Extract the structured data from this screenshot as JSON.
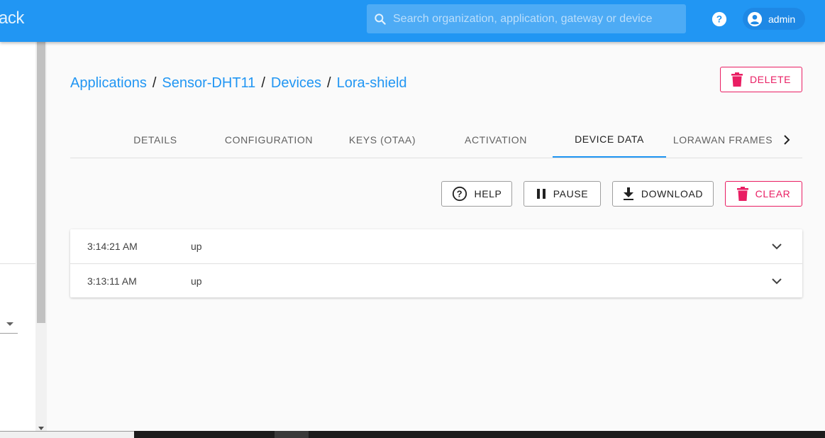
{
  "header": {
    "brand": "ack",
    "search_placeholder": "Search organization, application, gateway or device",
    "user_name": "admin"
  },
  "breadcrumb": {
    "items": [
      "Applications",
      "Sensor-DHT11",
      "Devices",
      "Lora-shield"
    ],
    "separator": "/"
  },
  "actions": {
    "delete_label": "DELETE"
  },
  "tabs": [
    {
      "label": "DETAILS",
      "active": false
    },
    {
      "label": "CONFIGURATION",
      "active": false
    },
    {
      "label": "KEYS (OTAA)",
      "active": false
    },
    {
      "label": "ACTIVATION",
      "active": false
    },
    {
      "label": "DEVICE DATA",
      "active": true
    },
    {
      "label": "LORAWAN FRAMES",
      "active": false
    }
  ],
  "toolbar": {
    "help_label": "HELP",
    "pause_label": "PAUSE",
    "download_label": "DOWNLOAD",
    "clear_label": "CLEAR"
  },
  "device_data": [
    {
      "time": "3:14:21 AM",
      "type": "up"
    },
    {
      "time": "3:13:11 AM",
      "type": "up"
    }
  ],
  "colors": {
    "primary": "#2196f3",
    "danger": "#e91e63"
  }
}
